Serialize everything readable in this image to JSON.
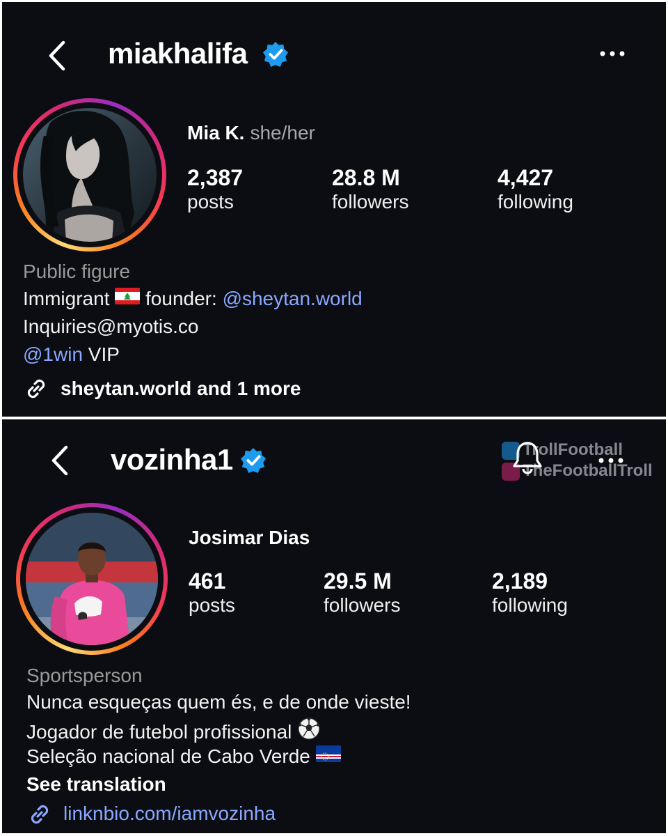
{
  "profiles": [
    {
      "username": "miakhalifa",
      "display_name": "Mia K.",
      "pronouns": "she/her",
      "stats": [
        {
          "value": "2,387",
          "label": "posts"
        },
        {
          "value": "28.8 M",
          "label": "followers"
        },
        {
          "value": "4,427",
          "label": "following"
        }
      ],
      "category": "Public figure",
      "bio": {
        "line1_a": "Immigrant",
        "line1_b": "founder:",
        "line1_mention": "@sheytan.world",
        "line2": "Inquiries@myotis.co",
        "line3_mention": "@1win",
        "line3_b": "VIP"
      },
      "link": "sheytan.world and 1 more"
    },
    {
      "username": "vozinha1",
      "display_name": "Josimar Dias",
      "stats": [
        {
          "value": "461",
          "label": "posts"
        },
        {
          "value": "29.5 M",
          "label": "followers"
        },
        {
          "value": "2,189",
          "label": "following"
        }
      ],
      "category": "Sportsperson",
      "bio": {
        "line1": "Nunca esqueças quem és, e de onde vieste!",
        "line2": "Jogador de futebol profissional",
        "line3": "Seleção nacional de Cabo Verde"
      },
      "see_translation": "See translation",
      "link": "linknbio.com/iamvozinha"
    }
  ],
  "watermark": {
    "line1": "TrollFootball",
    "line2": "TheFootballTroll"
  },
  "icons": [
    "back-chevron-icon",
    "verified-badge-icon",
    "more-options-icon",
    "link-icon",
    "lebanon-flag-icon",
    "soccer-ball-icon",
    "cape-verde-flag-icon",
    "notification-bell-icon",
    "twitter-icon",
    "instagram-icon"
  ],
  "colors": {
    "background": "#0b0d12",
    "verified": "#1d9bf0",
    "mention": "#8aa8ff",
    "muted": "#9a9a9a"
  }
}
